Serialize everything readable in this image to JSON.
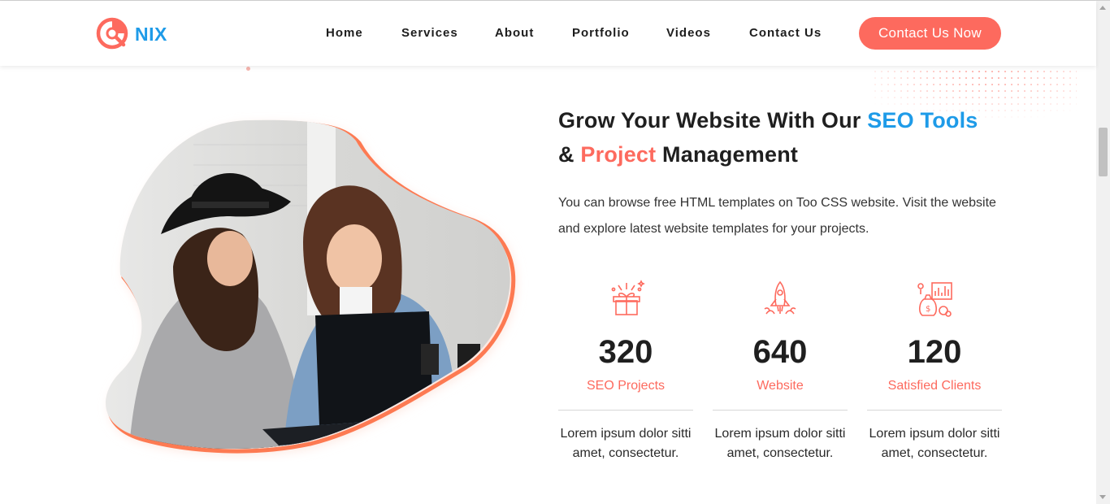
{
  "header": {
    "logo_text": "NIX",
    "nav": [
      {
        "label": "Home"
      },
      {
        "label": "Services"
      },
      {
        "label": "About"
      },
      {
        "label": "Portfolio"
      },
      {
        "label": "Videos"
      },
      {
        "label": "Contact Us"
      }
    ],
    "cta_label": "Contact Us Now"
  },
  "hero": {
    "headline_part1": "Grow Your Website With Our ",
    "headline_blue": "SEO Tools",
    "headline_amp": "& ",
    "headline_red": "Project",
    "headline_part2": " Management",
    "description": "You can browse free HTML templates on Too CSS website. Visit the website and explore latest website templates for your projects."
  },
  "stats": [
    {
      "icon": "gift-box-icon",
      "number": "320",
      "label": "SEO Projects",
      "text": "Lorem ipsum dolor sitti amet, consectetur."
    },
    {
      "icon": "rocket-icon",
      "number": "640",
      "label": "Website",
      "text": "Lorem ipsum dolor sitti amet, consectetur."
    },
    {
      "icon": "money-chart-icon",
      "number": "120",
      "label": "Satisfied Clients",
      "text": "Lorem ipsum dolor sitti amet, consectetur."
    }
  ],
  "colors": {
    "accent_red": "#fd6a5e",
    "accent_blue": "#1e9be8",
    "text_dark": "#1f1f1f"
  }
}
